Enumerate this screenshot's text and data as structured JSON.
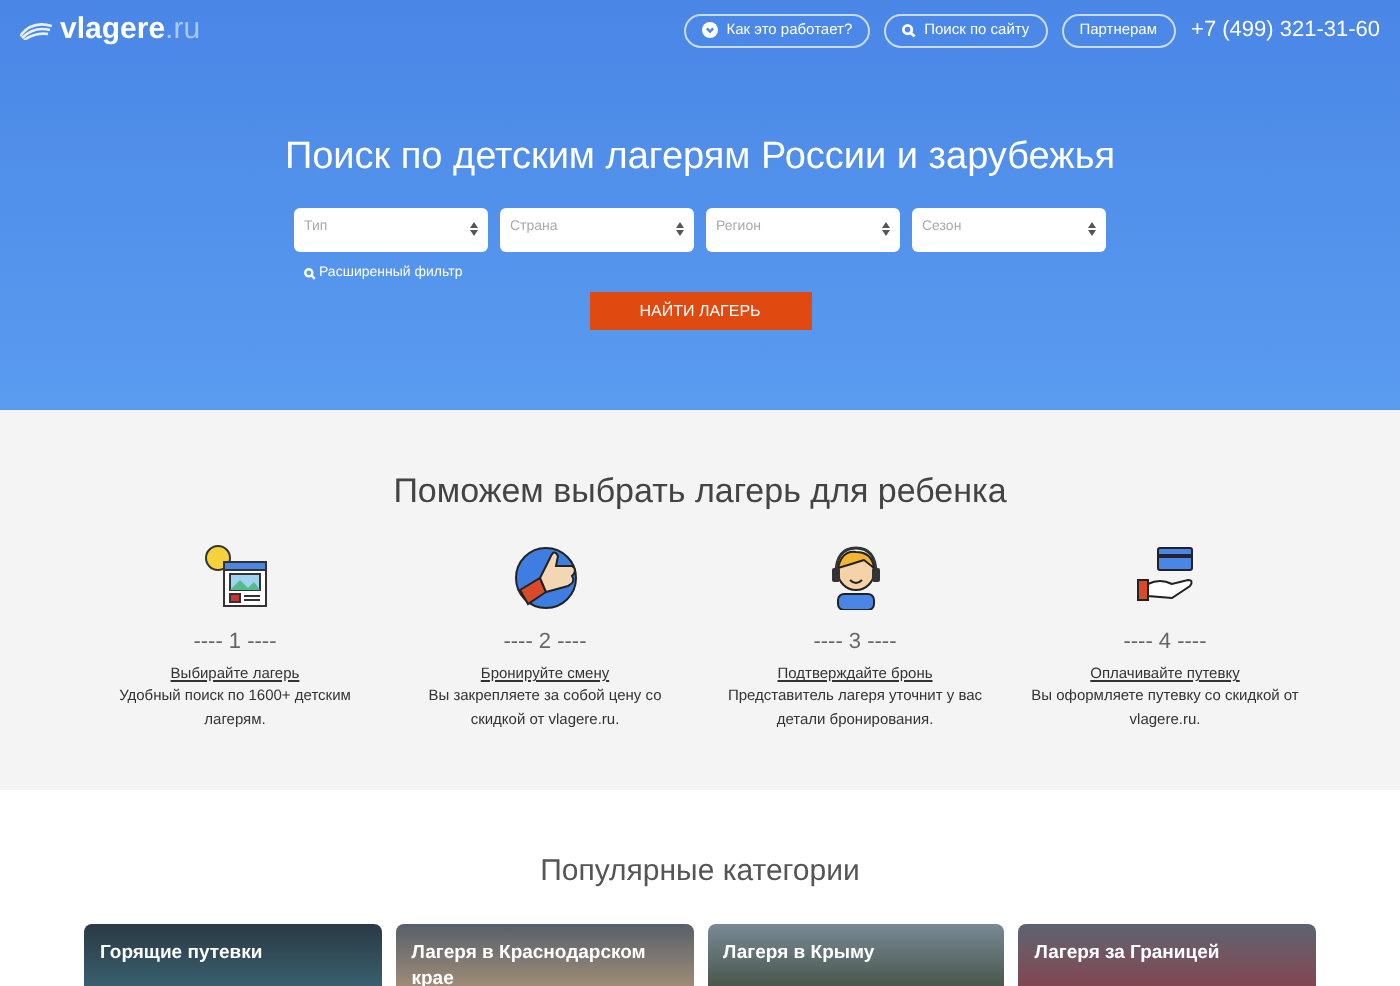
{
  "header": {
    "logo": {
      "name": "vlagere",
      "tld": ".ru"
    },
    "nav": [
      {
        "kind": "how",
        "label": "Как это работает?"
      },
      {
        "kind": "search",
        "label": "Поиск по сайту"
      },
      {
        "kind": "plain",
        "label": "Партнерам"
      }
    ],
    "phone": "+7 (499) 321-31-60"
  },
  "hero": {
    "title": "Поиск по детским лагерям России и зарубежья",
    "selects": [
      {
        "placeholder": "Тип"
      },
      {
        "placeholder": "Страна"
      },
      {
        "placeholder": "Регион"
      },
      {
        "placeholder": "Сезон"
      }
    ],
    "advanced_filter": "Расширенный фильтр",
    "submit": "НАЙТИ ЛАГЕРЬ"
  },
  "steps": {
    "title": "Поможем выбрать лагерь для ребенка",
    "items": [
      {
        "kind": "choose",
        "number": "---- 1 ----",
        "link": "Выбирайте лагерь",
        "text": "Удобный поиск по 1600+ детским лагерям."
      },
      {
        "kind": "book",
        "number": "---- 2 ----",
        "link": "Бронируйте смену",
        "text": "Вы закрепляете за собой цену со скидкой от vlagere.ru."
      },
      {
        "kind": "confirm",
        "number": "---- 3 ----",
        "link": "Подтверждайте бронь",
        "text": "Представитель лагеря уточнит у вас детали бронирования."
      },
      {
        "kind": "pay",
        "number": "---- 4 ----",
        "link": "Оплачивайте путевку",
        "text": "Вы оформляете путевку со скидкой от vlagere.ru."
      }
    ]
  },
  "categories": {
    "title": "Популярные категории",
    "items": [
      {
        "label": "Горящие путевки"
      },
      {
        "label": "Лагеря в Краснодарском крае"
      },
      {
        "label": "Лагеря в Крыму"
      },
      {
        "label": "Лагеря за Границей"
      }
    ]
  }
}
